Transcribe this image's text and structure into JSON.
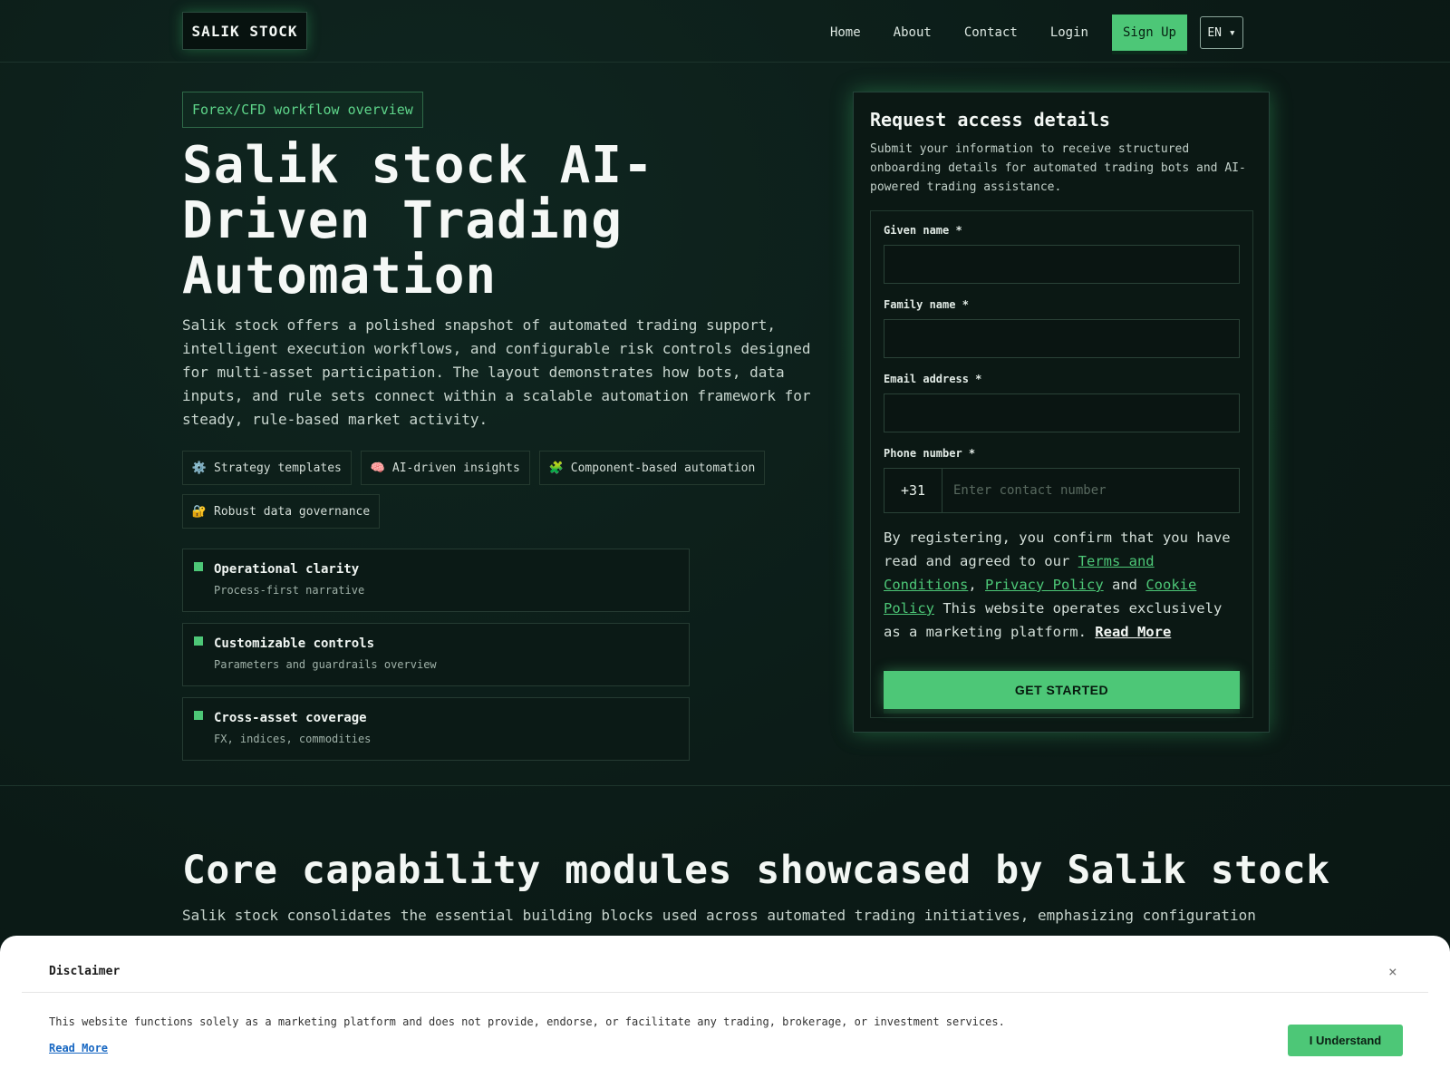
{
  "header": {
    "logo": "SALIK STOCK",
    "nav": [
      "Home",
      "About",
      "Contact",
      "Login"
    ],
    "signup": "Sign Up",
    "lang": "EN ▾"
  },
  "hero": {
    "eyebrow": "Forex/CFD workflow overview",
    "title": "Salik stock AI-Driven Trading Automation",
    "description": "Salik stock offers a polished snapshot of automated trading support, intelligent execution workflows, and configurable risk controls designed for multi-asset participation. The layout demonstrates how bots, data inputs, and rule sets connect within a scalable automation framework for steady, rule-based market activity.",
    "chips": [
      {
        "icon": "⚙️",
        "icon_name": "gear-icon",
        "label": "Strategy templates"
      },
      {
        "icon": "🧠",
        "icon_name": "brain-icon",
        "label": "AI-driven insights"
      },
      {
        "icon": "🧩",
        "icon_name": "puzzle-icon",
        "label": "Component-based automation"
      },
      {
        "icon": "🔐",
        "icon_name": "lock-icon",
        "label": "Robust data governance"
      }
    ],
    "features": [
      {
        "title": "Operational clarity",
        "subtitle": "Process-first narrative"
      },
      {
        "title": "Customizable controls",
        "subtitle": "Parameters and guardrails overview"
      },
      {
        "title": "Cross-asset coverage",
        "subtitle": "FX, indices, commodities"
      }
    ]
  },
  "form": {
    "title": "Request access details",
    "subtitle": "Submit your information to receive structured onboarding details for automated trading bots and AI-powered trading assistance.",
    "given_label": "Given name *",
    "family_label": "Family name *",
    "email_label": "Email address *",
    "phone_label": "Phone number *",
    "phone_code": "+31",
    "phone_placeholder": "Enter contact number",
    "legal_pre": "By registering, you confirm that you have read and agreed to our ",
    "terms": "Terms and Conditions",
    "comma": ", ",
    "privacy": "Privacy Policy",
    "and": " and ",
    "cookie": "Cookie Policy",
    "legal_post": " This website operates exclusively as a marketing platform. ",
    "read_more": "Read More",
    "cta": "GET STARTED"
  },
  "section": {
    "title": "Core capability modules showcased by Salik stock",
    "description": "Salik stock consolidates the essential building blocks used across automated trading initiatives, emphasizing configuration"
  },
  "disclaimer": {
    "title": "Disclaimer",
    "close": "×",
    "text": "This website functions solely as a marketing platform and does not provide, endorse, or facilitate any trading, brokerage, or investment services.",
    "read_more": "Read More",
    "button": "I Understand"
  },
  "colors": {
    "accent": "#4dc777",
    "background": "#0c1b17"
  }
}
